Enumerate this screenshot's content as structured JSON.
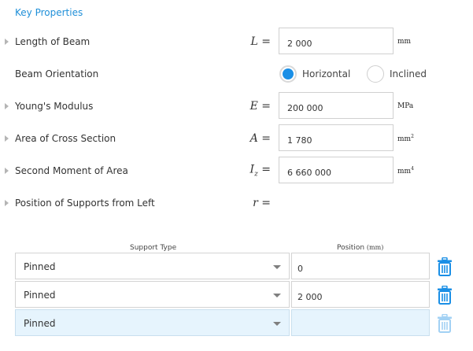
{
  "section_title": "Key Properties",
  "properties": {
    "length": {
      "label": "Length of Beam",
      "symbol": "L",
      "eq": "=",
      "value": "2 000",
      "unit": "mm"
    },
    "orientation": {
      "label": "Beam Orientation",
      "options": [
        {
          "label": "Horizontal",
          "selected": true
        },
        {
          "label": "Inclined",
          "selected": false
        }
      ]
    },
    "youngs": {
      "label": "Young's Modulus",
      "symbol": "E",
      "eq": "=",
      "value": "200 000",
      "unit": "MPa"
    },
    "area": {
      "label": "Area of Cross Section",
      "symbol": "A",
      "eq": "=",
      "value": "1 780",
      "unit": "mm",
      "unit_sup": "2"
    },
    "moment": {
      "label": "Second Moment of Area",
      "symbol": "I",
      "symbol_sub": "z",
      "eq": "=",
      "value": "6 660 000",
      "unit": "mm",
      "unit_sup": "4"
    },
    "supports": {
      "label": "Position of Supports from Left",
      "symbol": "r",
      "eq": "="
    }
  },
  "supports_table": {
    "col_type": "Support Type",
    "col_position": "Position",
    "col_position_unit": "(mm)",
    "rows": [
      {
        "type": "Pinned",
        "position": "0"
      },
      {
        "type": "Pinned",
        "position": "2 000"
      },
      {
        "type": "Pinned",
        "position": ""
      }
    ]
  },
  "colors": {
    "accent": "#1a8fe6",
    "title": "#1f8fd8",
    "highlight_row": "#e6f4fd"
  },
  "icons": {
    "caret": "caret-right-icon",
    "delete": "trash-icon",
    "dropdown": "chevron-down-icon"
  }
}
